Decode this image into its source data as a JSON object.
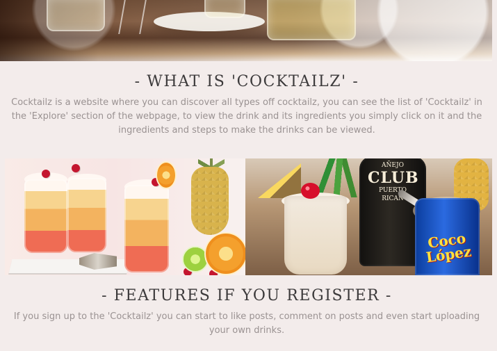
{
  "about": {
    "title": "- WHAT IS 'COCKTAILZ' -",
    "description": "Cocktailz is a website where you can discover all types off cocktailz, you can see the list of 'Cocktailz' in the 'Explore' section of the webpage, to view the drink and its ingredients you simply click on it and the ingredients and steps to make the drinks can be viewed."
  },
  "features": {
    "title": "- FEATURES IF YOU REGISTER -",
    "description": "If you sign up to the 'Cocktailz' you can start to like posts, comment on posts and even start uploading your own drinks."
  },
  "product_image": {
    "bottle_label_top": "AÑEJO",
    "bottle_label_main": "CLUB",
    "bottle_label_sub": "PUERTO RICAN",
    "can_brand": "Coco López"
  }
}
